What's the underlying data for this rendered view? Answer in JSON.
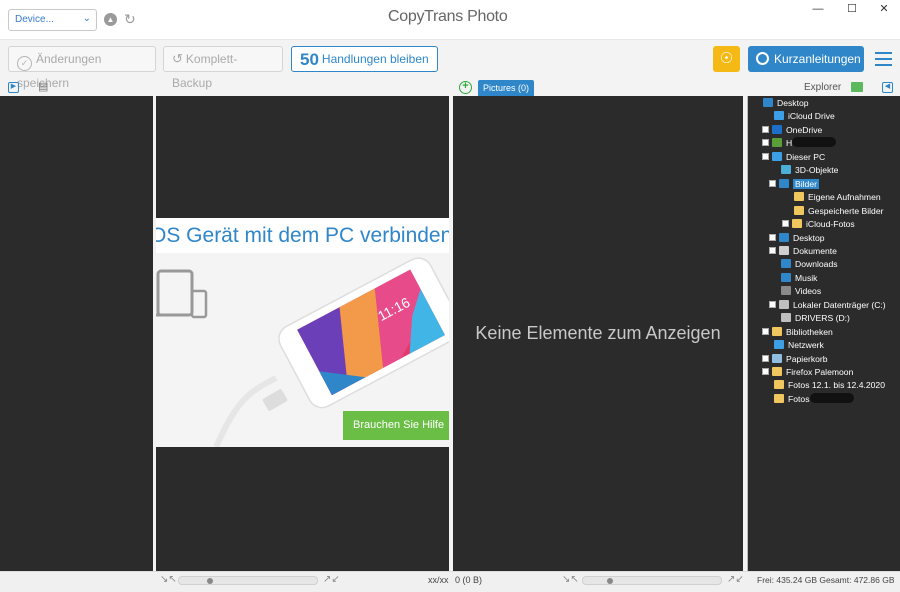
{
  "app": {
    "title": "CopyTrans Photo",
    "device_select": "Device...",
    "window": {
      "minimize": "—",
      "maximize": "☐",
      "close": "✕"
    }
  },
  "toolbar": {
    "save_label": "Änderungen speichern",
    "backup_label": "Komplett-Backup",
    "actions_count": "50",
    "actions_label": "Handlungen bleiben",
    "guide_label": "Kurzanleitungen"
  },
  "panels": {
    "pictures_tab": "Pictures (0)",
    "explorer_label": "Explorer",
    "empty_message": "Keine Elemente zum Anzeigen",
    "promo_title": "OS Gerät mit dem PC verbinden",
    "promo_button": "Brauchen Sie Hilfe"
  },
  "tree": [
    {
      "label": "Desktop",
      "indent": 0,
      "expander": false,
      "icon": "desktop-icon",
      "color": "#2f86c8"
    },
    {
      "label": "iCloud Drive",
      "indent": 1,
      "expander": false,
      "icon": "cloud-icon",
      "color": "#3da0e6"
    },
    {
      "label": "OneDrive",
      "indent": 1,
      "expander": true,
      "icon": "cloud-icon",
      "color": "#1e6fc9"
    },
    {
      "label": "H",
      "indent": 1,
      "expander": true,
      "icon": "user-icon",
      "color": "#5a9e3a",
      "redacted": true
    },
    {
      "label": "Dieser PC",
      "indent": 1,
      "expander": true,
      "icon": "computer-icon",
      "color": "#3da0e6"
    },
    {
      "label": "3D-Objekte",
      "indent": 2,
      "expander": false,
      "icon": "cube-icon",
      "color": "#4ab0d6"
    },
    {
      "label": "Bilder",
      "indent": 2,
      "expander": true,
      "icon": "pictures-icon",
      "color": "#2f86c8",
      "selected": true
    },
    {
      "label": "Eigene Aufnahmen",
      "indent": 3,
      "expander": false,
      "icon": "folder-icon",
      "color": "#f0c75e"
    },
    {
      "label": "Gespeicherte Bilder",
      "indent": 3,
      "expander": false,
      "icon": "folder-icon",
      "color": "#f0c75e"
    },
    {
      "label": "iCloud-Fotos",
      "indent": 3,
      "expander": true,
      "icon": "folder-icon",
      "color": "#f0c75e"
    },
    {
      "label": "Desktop",
      "indent": 2,
      "expander": true,
      "icon": "desktop-icon",
      "color": "#2f86c8"
    },
    {
      "label": "Dokumente",
      "indent": 2,
      "expander": true,
      "icon": "document-icon",
      "color": "#cfcfcf"
    },
    {
      "label": "Downloads",
      "indent": 2,
      "expander": false,
      "icon": "download-icon",
      "color": "#2f86c8"
    },
    {
      "label": "Musik",
      "indent": 2,
      "expander": false,
      "icon": "music-icon",
      "color": "#2f86c8"
    },
    {
      "label": "Videos",
      "indent": 2,
      "expander": false,
      "icon": "video-icon",
      "color": "#8a8a8a"
    },
    {
      "label": "Lokaler Datenträger (C:)",
      "indent": 2,
      "expander": true,
      "icon": "drive-icon",
      "color": "#bfbfbf"
    },
    {
      "label": "DRIVERS (D:)",
      "indent": 2,
      "expander": false,
      "icon": "drive-icon",
      "color": "#bfbfbf"
    },
    {
      "label": "Bibliotheken",
      "indent": 1,
      "expander": true,
      "icon": "library-icon",
      "color": "#f0c75e"
    },
    {
      "label": "Netzwerk",
      "indent": 1,
      "expander": false,
      "icon": "network-icon",
      "color": "#3da0e6"
    },
    {
      "label": "Papierkorb",
      "indent": 1,
      "expander": true,
      "icon": "trash-icon",
      "color": "#8fbde0"
    },
    {
      "label": "Firefox Palemoon",
      "indent": 1,
      "expander": true,
      "icon": "folder-icon",
      "color": "#f0c75e"
    },
    {
      "label": "Fotos 12.1. bis 12.4.2020",
      "indent": 1,
      "expander": false,
      "icon": "folder-icon",
      "color": "#f0c75e"
    },
    {
      "label": "Fotos",
      "indent": 1,
      "expander": false,
      "icon": "folder-icon",
      "color": "#f0c75e",
      "redacted": true
    }
  ],
  "status": {
    "device_size": "xx/xx",
    "pc_count": "0 (0 B)",
    "disk_space": "Frei: 435.24 GB Gesamt: 472.86 GB"
  }
}
